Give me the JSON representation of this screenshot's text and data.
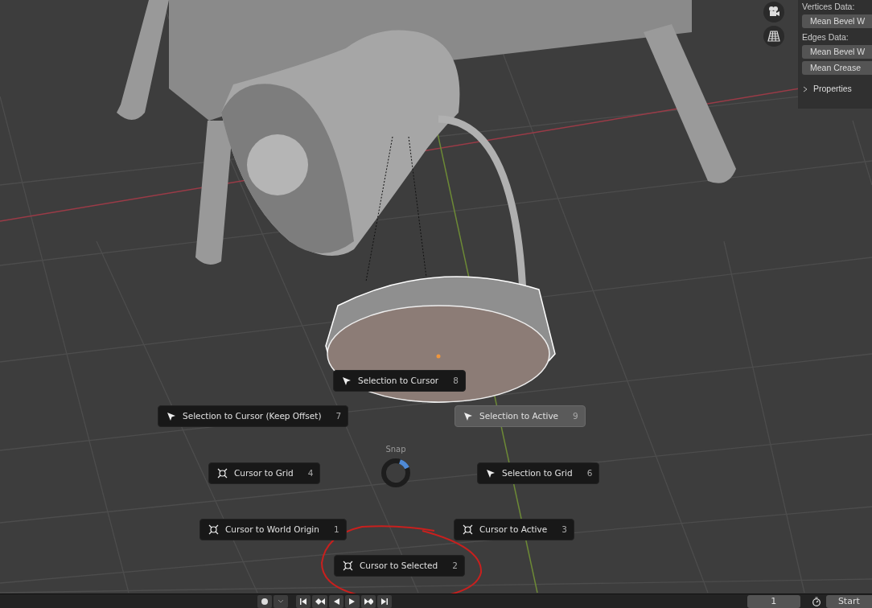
{
  "side_panel": {
    "sections": [
      {
        "heading": "Vertices Data:",
        "fields": [
          "Mean Bevel W"
        ]
      },
      {
        "heading": "Edges Data:",
        "fields": [
          "Mean Bevel W",
          "Mean Crease"
        ]
      }
    ],
    "subpanel": {
      "label": "Properties",
      "expanded": false
    }
  },
  "pie_menu": {
    "title": "Snap",
    "items": [
      {
        "kind": "selection",
        "label": "Selection to Cursor",
        "hotkey": "8",
        "selected": false
      },
      {
        "kind": "selection",
        "label": "Selection to Cursor (Keep Offset)",
        "hotkey": "7",
        "selected": false
      },
      {
        "kind": "selection",
        "label": "Selection to Active",
        "hotkey": "9",
        "selected": true
      },
      {
        "kind": "cursor",
        "label": "Cursor to Grid",
        "hotkey": "4",
        "selected": false
      },
      {
        "kind": "selection",
        "label": "Selection to Grid",
        "hotkey": "6",
        "selected": false
      },
      {
        "kind": "cursor",
        "label": "Cursor to World Origin",
        "hotkey": "1",
        "selected": false
      },
      {
        "kind": "cursor",
        "label": "Cursor to Active",
        "hotkey": "3",
        "selected": false
      },
      {
        "kind": "cursor",
        "label": "Cursor to Selected",
        "hotkey": "2",
        "selected": false
      }
    ]
  },
  "timeline": {
    "current_frame": "1",
    "start_label": "Start"
  }
}
